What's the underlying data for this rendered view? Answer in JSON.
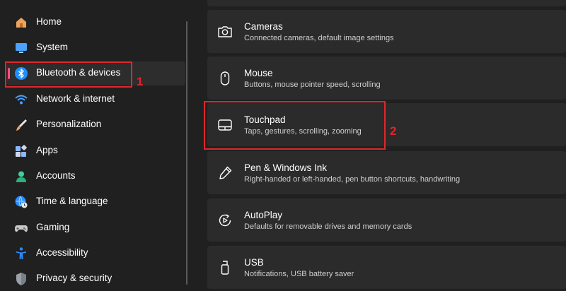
{
  "sidebar": {
    "items": [
      {
        "label": "Home",
        "icon": "home-icon"
      },
      {
        "label": "System",
        "icon": "system-icon"
      },
      {
        "label": "Bluetooth & devices",
        "icon": "bluetooth-icon",
        "selected": true
      },
      {
        "label": "Network & internet",
        "icon": "wifi-icon"
      },
      {
        "label": "Personalization",
        "icon": "brush-icon"
      },
      {
        "label": "Apps",
        "icon": "apps-icon"
      },
      {
        "label": "Accounts",
        "icon": "account-icon"
      },
      {
        "label": "Time & language",
        "icon": "globe-clock-icon"
      },
      {
        "label": "Gaming",
        "icon": "gamepad-icon"
      },
      {
        "label": "Accessibility",
        "icon": "accessibility-icon"
      },
      {
        "label": "Privacy & security",
        "icon": "shield-icon"
      }
    ]
  },
  "main": {
    "cards": [
      {
        "title": "",
        "subtitle": ""
      },
      {
        "title": "Cameras",
        "subtitle": "Connected cameras, default image settings",
        "icon": "camera-icon"
      },
      {
        "title": "Mouse",
        "subtitle": "Buttons, mouse pointer speed, scrolling",
        "icon": "mouse-icon"
      },
      {
        "title": "Touchpad",
        "subtitle": "Taps, gestures, scrolling, zooming",
        "icon": "touchpad-icon"
      },
      {
        "title": "Pen & Windows Ink",
        "subtitle": "Right-handed or left-handed, pen button shortcuts, handwriting",
        "icon": "pen-icon"
      },
      {
        "title": "AutoPlay",
        "subtitle": "Defaults for removable drives and memory cards",
        "icon": "autoplay-icon"
      },
      {
        "title": "USB",
        "subtitle": "Notifications, USB battery saver",
        "icon": "usb-icon"
      }
    ]
  },
  "annotations": {
    "step1": "1",
    "step2": "2",
    "highlight_color": "#e0262b"
  },
  "colors": {
    "selected_indicator": "#ff4c8a",
    "card_background": "#2b2b2b",
    "page_background": "#202020"
  }
}
